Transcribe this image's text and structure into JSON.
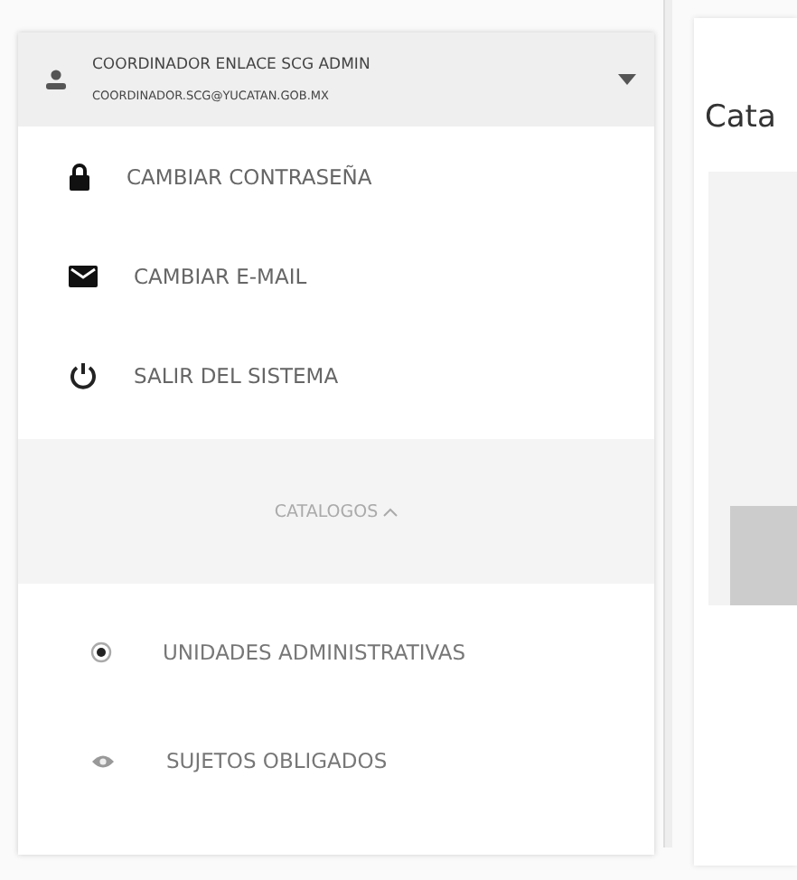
{
  "user_menu": {
    "name": "COORDINADOR ENLACE SCG ADMIN",
    "email": "COORDINADOR.SCG@YUCATAN.GOB.MX",
    "expanded": true
  },
  "account_items": [
    {
      "kind": "lock",
      "label": "CAMBIAR CONTRASEÑA"
    },
    {
      "kind": "mail",
      "label": "CAMBIAR E-MAIL"
    },
    {
      "kind": "power",
      "label": "SALIR DEL SISTEMA"
    }
  ],
  "catalog_section": {
    "label": "CATALOGOS",
    "expanded": true
  },
  "catalog_items": [
    {
      "kind": "target",
      "label": "UNIDADES ADMINISTRATIVAS"
    },
    {
      "kind": "eye",
      "label": "SUJETOS OBLIGADOS"
    }
  ],
  "main": {
    "title": "Cata"
  }
}
